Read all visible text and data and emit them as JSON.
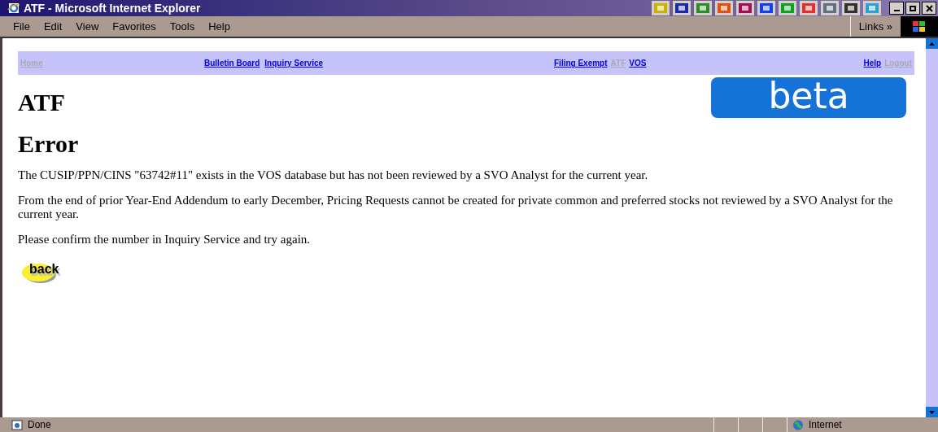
{
  "window": {
    "title": "ATF - Microsoft Internet Explorer"
  },
  "menu": [
    "File",
    "Edit",
    "View",
    "Favorites",
    "Tools",
    "Help"
  ],
  "links_bar": {
    "label": "Links",
    "chevron": "»"
  },
  "nav": [
    [
      {
        "label": "Home",
        "disabled": true
      }
    ],
    [
      {
        "label": "Bulletin Board",
        "disabled": false
      },
      {
        "label": "Inquiry Service",
        "disabled": false
      }
    ],
    [
      {
        "label": "Filing Exempt",
        "disabled": false
      },
      {
        "label": "ATF",
        "disabled": true
      },
      {
        "label": "VOS",
        "disabled": false
      }
    ],
    [
      {
        "label": "Help",
        "disabled": false
      },
      {
        "label": "Logout",
        "disabled": true
      }
    ]
  ],
  "logo": "beta",
  "heading": "ATF",
  "subheading": "Error",
  "paragraphs": [
    "The CUSIP/PPN/CINS \"63742#11\" exists in the VOS database but has not been reviewed by a SVO Analyst for the current year.",
    "From the end of prior Year-End Addendum to early December, Pricing Requests cannot be created for private common and preferred stocks not reviewed by a SVO Analyst for the current year.",
    "Please confirm the number in Inquiry Service and try again."
  ],
  "back_button": "back",
  "status_bar": {
    "text": "Done",
    "zone": "Internet"
  }
}
